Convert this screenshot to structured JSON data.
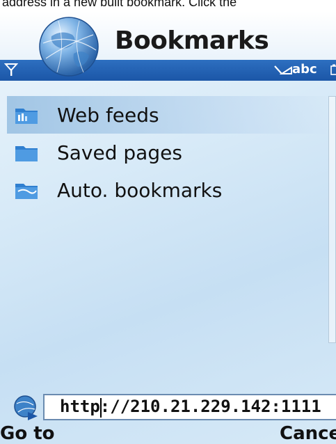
{
  "caption": {
    "text": "r address in a new built bookmark. Click the"
  },
  "header": {
    "title": "Bookmarks"
  },
  "status_bar": {
    "input_mode": "abc"
  },
  "list": {
    "items": [
      {
        "label": "Web feeds",
        "selected": true,
        "icon": "web-feeds-folder-icon"
      },
      {
        "label": "Saved pages",
        "selected": false,
        "icon": "saved-pages-folder-icon"
      },
      {
        "label": "Auto. bookmarks",
        "selected": false,
        "icon": "auto-bookmarks-folder-icon"
      }
    ]
  },
  "address_bar": {
    "value": "http://210.21.229.142:1111"
  },
  "softkeys": {
    "left": "Go to",
    "right": "Cancel"
  },
  "colors": {
    "status_bar": "#1b56a7",
    "selection": "#96bee1",
    "folder": "#2f7fd0"
  }
}
